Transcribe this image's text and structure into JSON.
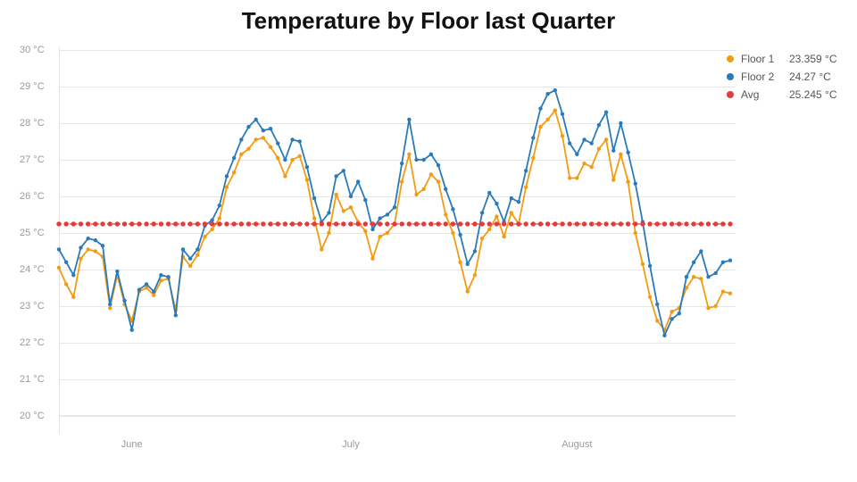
{
  "title": "Temperature by Floor last Quarter",
  "legend": {
    "items": [
      {
        "name": "Floor 1",
        "value": "23.359 °C",
        "color": "#f39c12"
      },
      {
        "name": "Floor 2",
        "value": "24.27 °C",
        "color": "#2b7bba"
      },
      {
        "name": "Avg",
        "value": "25.245 °C",
        "color": "#e43b3b"
      }
    ]
  },
  "axes": {
    "y_unit": "°C",
    "y_ticks": [
      20,
      21,
      22,
      23,
      24,
      25,
      26,
      27,
      28,
      29,
      30
    ],
    "x_ticks": [
      {
        "label": "June",
        "index": 10
      },
      {
        "label": "July",
        "index": 40
      },
      {
        "label": "August",
        "index": 71
      }
    ]
  },
  "chart_data": {
    "type": "line",
    "title": "Temperature by Floor last Quarter",
    "xlabel": "",
    "ylabel": "°C",
    "ylim": [
      20,
      30
    ],
    "x_index_range": [
      0,
      92
    ],
    "x_tick_labels": [
      "June",
      "July",
      "August"
    ],
    "series": [
      {
        "name": "Floor 1",
        "color": "#f39c12",
        "values": [
          24.05,
          23.6,
          23.25,
          24.3,
          24.55,
          24.5,
          24.35,
          22.95,
          23.85,
          23.05,
          22.6,
          23.4,
          23.5,
          23.3,
          23.7,
          23.75,
          22.9,
          24.35,
          24.1,
          24.4,
          24.9,
          25.1,
          25.4,
          26.25,
          26.65,
          27.15,
          27.3,
          27.55,
          27.6,
          27.35,
          27.05,
          26.55,
          27.0,
          27.1,
          26.45,
          25.4,
          24.55,
          25.0,
          26.05,
          25.6,
          25.7,
          25.3,
          25.05,
          24.3,
          24.9,
          25.0,
          25.25,
          26.4,
          27.15,
          26.05,
          26.2,
          26.6,
          26.4,
          25.5,
          25.0,
          24.2,
          23.4,
          23.85,
          24.85,
          25.1,
          25.45,
          24.9,
          25.55,
          25.25,
          26.25,
          27.05,
          27.9,
          28.1,
          28.35,
          27.65,
          26.5,
          26.5,
          26.9,
          26.8,
          27.3,
          27.55,
          26.45,
          27.15,
          26.4,
          25.0,
          24.15,
          23.25,
          22.6,
          22.35,
          22.85,
          22.95,
          23.5,
          23.8,
          23.75,
          22.95,
          23.0,
          23.4,
          23.35
        ]
      },
      {
        "name": "Floor 2",
        "color": "#2b7bba",
        "values": [
          24.55,
          24.2,
          23.85,
          24.6,
          24.85,
          24.8,
          24.65,
          23.05,
          23.95,
          23.15,
          22.35,
          23.45,
          23.6,
          23.4,
          23.85,
          23.8,
          22.75,
          24.55,
          24.3,
          24.55,
          25.2,
          25.35,
          25.75,
          26.55,
          27.05,
          27.55,
          27.9,
          28.1,
          27.8,
          27.85,
          27.45,
          27.0,
          27.55,
          27.5,
          26.8,
          25.95,
          25.3,
          25.55,
          26.55,
          26.7,
          26.0,
          26.4,
          25.9,
          25.1,
          25.4,
          25.5,
          25.7,
          26.9,
          28.1,
          27.0,
          27.0,
          27.15,
          26.85,
          26.2,
          25.65,
          24.95,
          24.15,
          24.5,
          25.55,
          26.1,
          25.8,
          25.3,
          25.95,
          25.85,
          26.7,
          27.6,
          28.4,
          28.8,
          28.9,
          28.25,
          27.45,
          27.15,
          27.55,
          27.45,
          27.95,
          28.3,
          27.25,
          28.0,
          27.2,
          26.35,
          25.3,
          24.1,
          23.05,
          22.2,
          22.65,
          22.8,
          23.8,
          24.2,
          24.5,
          23.8,
          23.9,
          24.2,
          24.25
        ]
      },
      {
        "name": "Avg",
        "color": "#e43b3b",
        "constant": 25.245
      }
    ]
  }
}
